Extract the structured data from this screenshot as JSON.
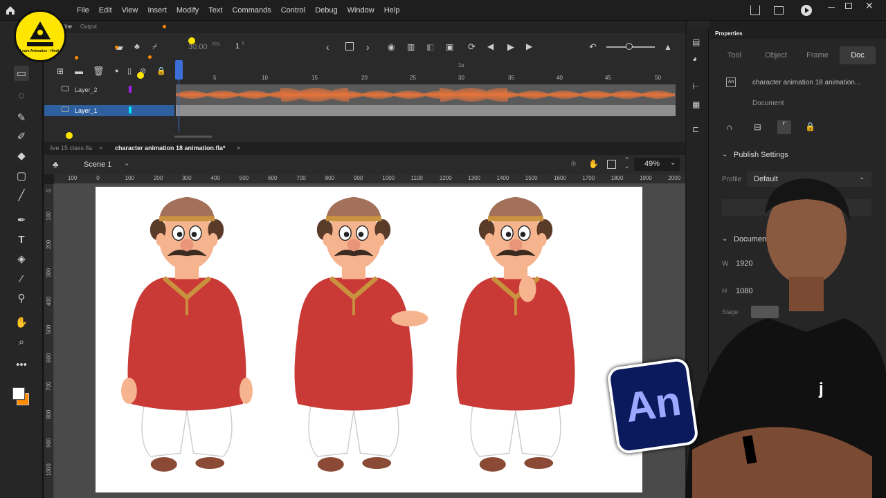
{
  "menu": [
    "File",
    "Edit",
    "View",
    "Insert",
    "Modify",
    "Text",
    "Commands",
    "Control",
    "Debug",
    "Window",
    "Help"
  ],
  "logo": {
    "text": "Learn Animation - Hindi"
  },
  "timeline": {
    "tab_timeline": "Timeline",
    "tab_output": "Output",
    "fps": "30.00",
    "fps_unit": "FPS",
    "frame": "1",
    "frame_unit": "F",
    "seconds_marker": "1s",
    "frame_numbers": [
      "5",
      "10",
      "15",
      "20",
      "25",
      "30",
      "35",
      "40",
      "45",
      "50"
    ],
    "layers": [
      {
        "name": "Layer_2",
        "color": "#a020f0"
      },
      {
        "name": "Layer_1",
        "color": "#00e5ff"
      }
    ]
  },
  "doc_tabs": [
    {
      "label": "live 15 class.fla",
      "active": false
    },
    {
      "label": "character animation 18 animation.fla*",
      "active": true
    }
  ],
  "scene": {
    "name": "Scene 1",
    "zoom": "49%"
  },
  "hruler_numbers": [
    "100",
    "0",
    "100",
    "200",
    "300",
    "400",
    "500",
    "600",
    "700",
    "800",
    "900",
    "1000",
    "1100",
    "1200",
    "1300",
    "1400",
    "1500",
    "1600",
    "1700",
    "1800",
    "1900",
    "2000"
  ],
  "vruler_numbers": [
    "0",
    "100",
    "200",
    "300",
    "400",
    "500",
    "600",
    "700",
    "800",
    "900",
    "1000"
  ],
  "properties": {
    "title": "Properties",
    "tabs": [
      "Tool",
      "Object",
      "Frame",
      "Doc"
    ],
    "active_tab": "Doc",
    "doc_name": "character animation 18 animation...",
    "doc_label": "Document",
    "publish_settings": "Publish Settings",
    "profile_label": "Profile",
    "profile_value": "Default",
    "document_section": "Document",
    "w_label": "W",
    "w_value": "1920",
    "h_label": "H",
    "h_value": "1080",
    "stage_label": "Stage"
  },
  "badge": {
    "text": "An"
  },
  "colors": {
    "kurta": "#c93a36",
    "collar": "#c9923f",
    "skin": "#f6b48e",
    "cap": "#a3705a",
    "hair": "#5a3a28",
    "shoe": "#8a4a36",
    "accent": "#3c6ed8",
    "badge_bg": "#0b1a5c",
    "badge_text": "#9aa8ff",
    "waveform": "#e8743a"
  }
}
